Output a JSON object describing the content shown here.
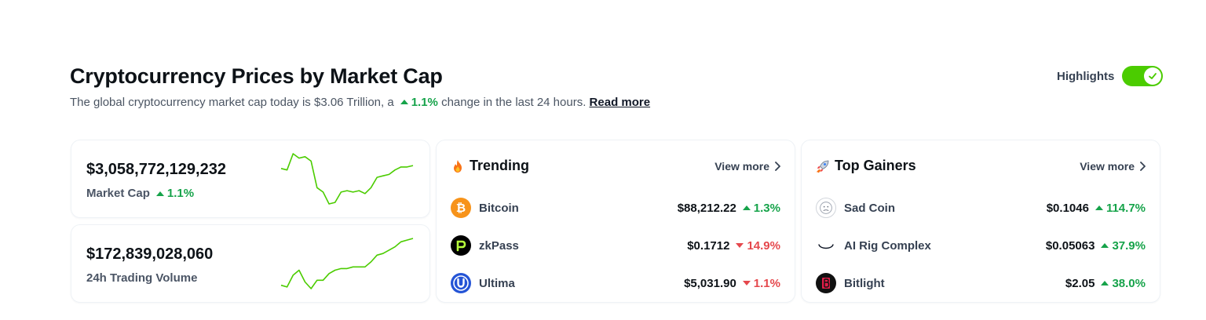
{
  "header": {
    "title": "Cryptocurrency Prices by Market Cap",
    "subtitle_prefix": "The global cryptocurrency market cap today is $3.06 Trillion, a",
    "subtitle_change": "1.1%",
    "subtitle_suffix": "change in the last 24 hours.",
    "read_more": "Read more"
  },
  "highlights": {
    "label": "Highlights",
    "enabled": true,
    "accent": "#4bcc00"
  },
  "stats": [
    {
      "value": "$3,058,772,129,232",
      "label": "Market Cap",
      "change": "1.1%",
      "direction": "up",
      "sparkline": [
        70,
        68,
        90,
        84,
        86,
        80,
        44,
        38,
        22,
        24,
        38,
        40,
        38,
        40,
        36,
        44,
        58,
        60,
        62,
        68,
        72,
        72,
        74
      ]
    },
    {
      "value": "$172,839,028,060",
      "label": "24h Trading Volume",
      "sparkline": [
        24,
        22,
        36,
        42,
        28,
        20,
        30,
        30,
        38,
        42,
        44,
        44,
        46,
        46,
        46,
        52,
        60,
        62,
        66,
        70,
        76,
        78,
        80
      ]
    }
  ],
  "trending": {
    "icon": "fire-icon",
    "title": "Trending",
    "view_more": "View more",
    "items": [
      {
        "name": "Bitcoin",
        "price": "$88,212.22",
        "change": "1.3%",
        "direction": "up",
        "icon": "bitcoin-icon",
        "color": "#f7931a"
      },
      {
        "name": "zkPass",
        "price": "$0.1712",
        "change": "14.9%",
        "direction": "down",
        "icon": "zkpass-icon",
        "color": "#000000"
      },
      {
        "name": "Ultima",
        "price": "$5,031.90",
        "change": "1.1%",
        "direction": "down",
        "icon": "ultima-icon",
        "color": "#2454d6"
      }
    ]
  },
  "gainers": {
    "icon": "rocket-icon",
    "title": "Top Gainers",
    "view_more": "View more",
    "items": [
      {
        "name": "Sad Coin",
        "price": "$0.1046",
        "change": "114.7%",
        "direction": "up",
        "icon": "sad-coin-icon"
      },
      {
        "name": "AI Rig Complex",
        "price": "$0.05063",
        "change": "37.9%",
        "direction": "up",
        "icon": "ai-rig-complex-icon"
      },
      {
        "name": "Bitlight",
        "price": "$2.05",
        "change": "38.0%",
        "direction": "up",
        "icon": "bitlight-icon"
      }
    ]
  },
  "colors": {
    "up": "#16a34a",
    "down": "#e5484d",
    "text": "#0d1217",
    "muted": "#4b5565"
  }
}
